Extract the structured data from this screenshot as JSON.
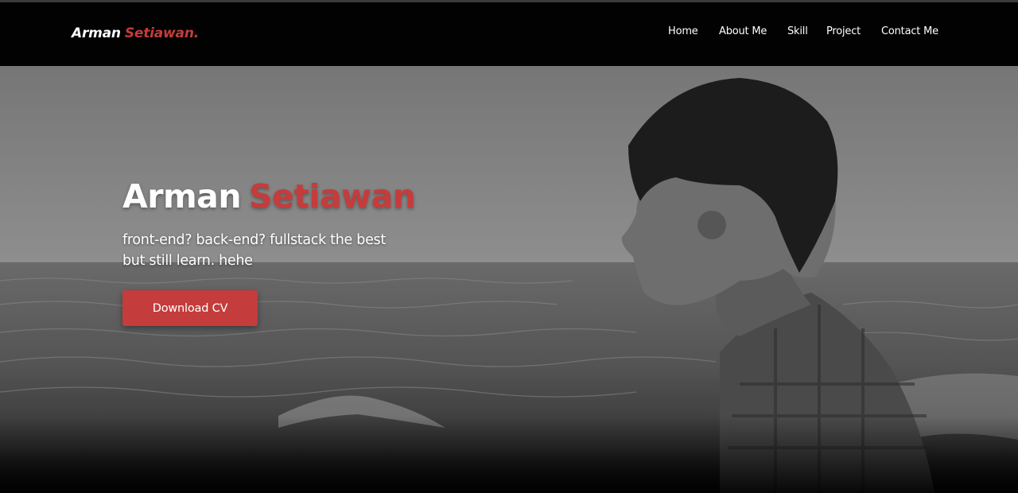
{
  "brand": {
    "name": "Arman",
    "accent": "Setiawan."
  },
  "nav": {
    "home": "Home",
    "about": "About Me",
    "skill": "Skill",
    "project": "Project",
    "contact": "Contact Me"
  },
  "hero": {
    "title_first": "Arman",
    "title_accent": "Setiawan",
    "subtitle_line1": "front-end? back-end? fullstack the best",
    "subtitle_line2": "but still learn. hehe",
    "cta_label": "Download CV"
  },
  "colors": {
    "accent": "#c43c3c",
    "navbar_bg": "#020202",
    "text": "#ffffff"
  }
}
